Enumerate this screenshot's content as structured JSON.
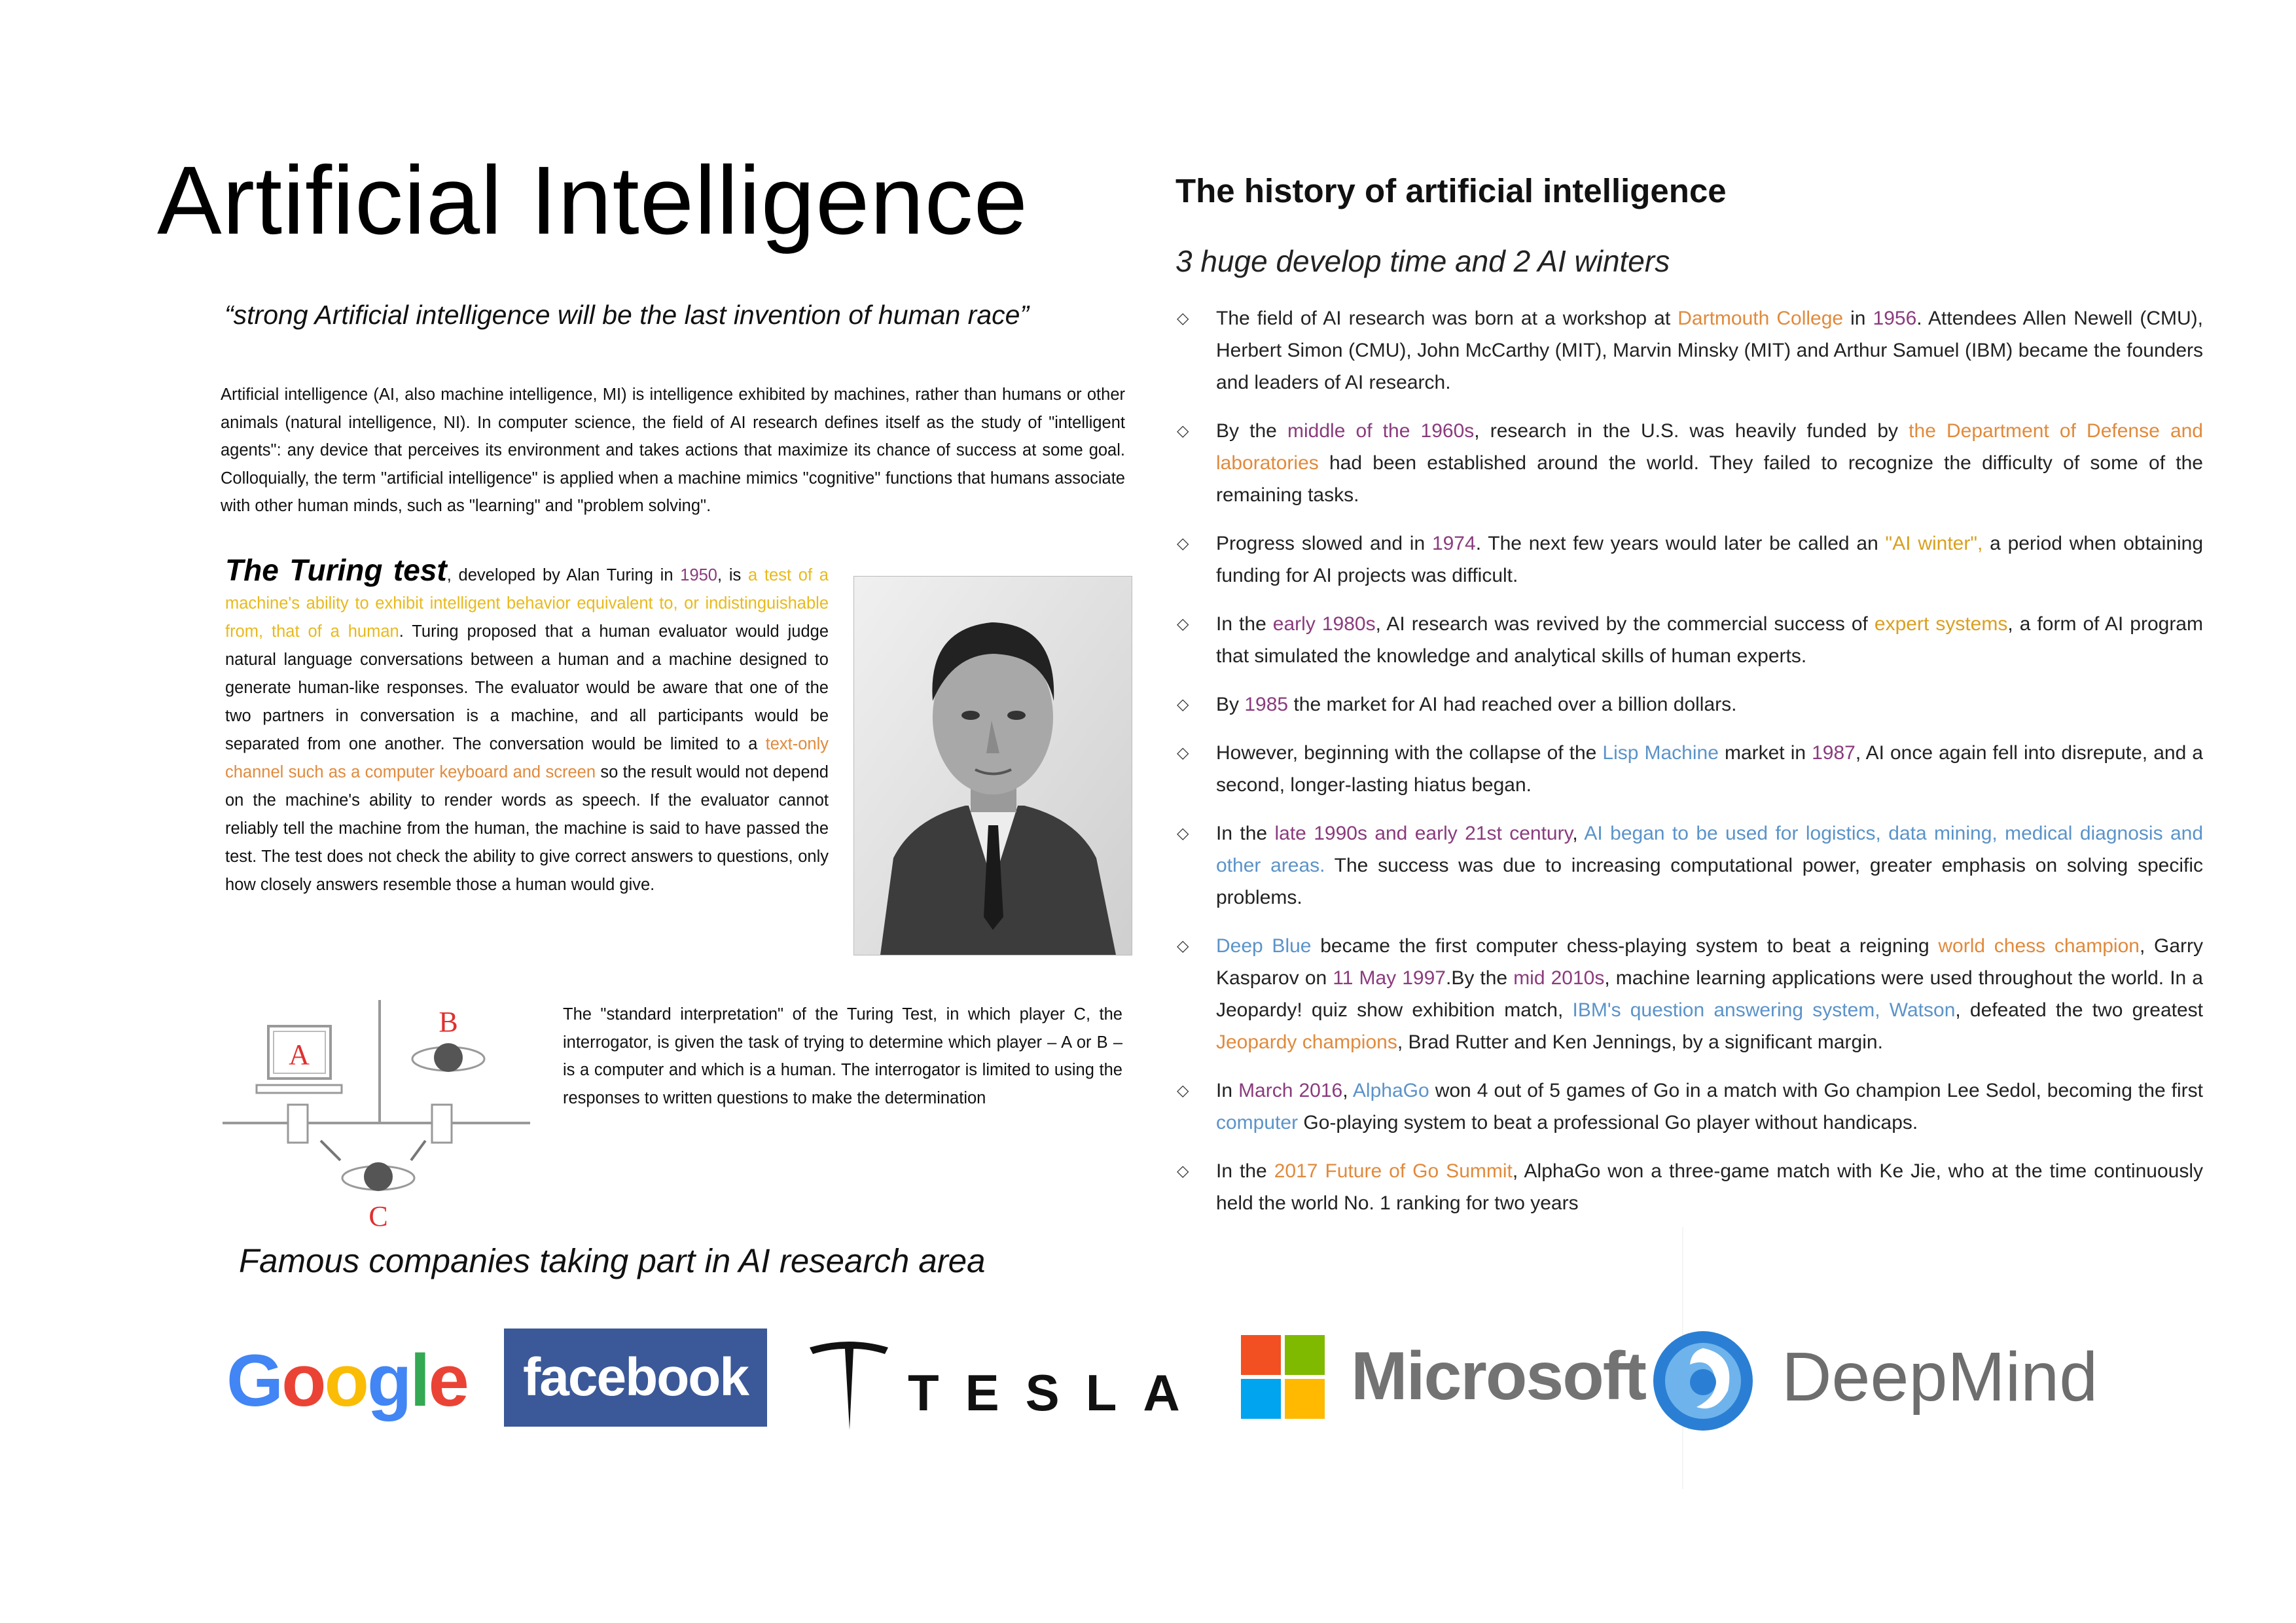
{
  "left": {
    "title": "Artificial Intelligence",
    "quote": "“strong Artificial intelligence will be the last invention of human race”",
    "intro": "Artificial intelligence (AI, also machine intelligence, MI) is intelligence exhibited by machines, rather than humans or other animals (natural intelligence, NI). In computer science, the field of AI research defines itself as the study of \"intelligent agents\": any device that perceives its environment and takes actions that maximize its chance of success at some goal. Colloquially, the term \"artificial intelligence\" is applied when a machine mimics \"cognitive\" functions that humans associate with other human minds, such as \"learning\" and \"problem solving\".",
    "turing": {
      "heading": "The Turing test",
      "s1": ", developed by Alan Turing in ",
      "year": "1950",
      "s2": ", is ",
      "def": "a test of a machine's ability to exhibit intelligent behavior equivalent to, or indistinguishable from, that of a human",
      "s3": ". Turing proposed that a human evaluator would judge natural language conversations between a human and a machine designed to generate human-like responses. The evaluator would be aware that one of the two partners in conversation is a machine, and all participants would be separated from one another. The conversation would be limited to a ",
      "channel": "text-only channel such as a computer keyboard and screen",
      "s4": " so the result would not depend on the machine's ability to render words as speech. If the evaluator cannot reliably tell the machine from the human, the machine is said to have passed the test. The test does not check the ability to give correct answers to questions, only how closely answers resemble those a human would give."
    },
    "diagram": {
      "label_a": "A",
      "label_b": "B",
      "label_c": "C"
    },
    "diagram_caption": "The \"standard interpretation\" of the Turing Test, in which player C, the interrogator, is given the task of trying to determine which player – A or B – is a computer and which is a human. The interrogator is limited to using the responses to written questions to make the determination",
    "companies_heading": "Famous companies taking part in AI research area"
  },
  "right": {
    "title": "The history of artificial intelligence",
    "subtitle": "3 huge develop time and 2 AI winters",
    "items": [
      {
        "a": "The field of AI research was born at a workshop at ",
        "b": "Dartmouth College",
        "c": " in ",
        "d": "1956",
        "e": ". Attendees Allen Newell (CMU), Herbert Simon (CMU), John McCarthy (MIT), Marvin Minsky (MIT) and Arthur Samuel (IBM) became the founders and leaders of AI research."
      },
      {
        "a": "By the ",
        "b": "middle of the 1960s",
        "c": ", research in the U.S. was heavily funded by ",
        "d": "the Department of Defense and laboratories",
        "e": " had been established around the world. They failed to recognize the difficulty of some of the remaining tasks."
      },
      {
        "a": "Progress slowed and in ",
        "b": "1974",
        "c": ". The next few years would later be called an ",
        "d": "\"AI winter\",",
        "e": " a period when obtaining funding for AI projects was difficult."
      },
      {
        "a": "In the ",
        "b": "early 1980s",
        "c": ", AI research was revived by the commercial success of ",
        "d": "expert systems",
        "e": ", a form of AI program that simulated the knowledge and analytical skills of human experts."
      },
      {
        "a": "By ",
        "b": "1985",
        "c": " the market for AI had reached over a billion dollars."
      },
      {
        "a": "However, beginning with the collapse of the ",
        "b": "Lisp Machine",
        "c": " market in ",
        "d": "1987",
        "e": ", AI once again fell into disrepute, and a second, longer-lasting hiatus began."
      },
      {
        "a": "In the ",
        "b": "late 1990s and early 21st century",
        "c": ", ",
        "d": "AI began to be used for logistics, data mining, medical diagnosis and other areas.",
        "e": " The success was due to increasing computational power, greater emphasis on solving specific problems."
      },
      {
        "a": "Deep Blue",
        "b": " became the first computer chess-playing system to beat a reigning ",
        "c": "world chess champion",
        "d": ", Garry Kasparov on ",
        "e": "11 May 1997",
        "f": ".By the ",
        "g": "mid 2010s",
        "h": ", machine learning applications were used throughout the world. In a Jeopardy! quiz show exhibition match, ",
        "i": "IBM's question answering system, Watson",
        "j": ", defeated the two greatest ",
        "k": "Jeopardy champions",
        "l": ", Brad Rutter and Ken Jennings, by a significant margin."
      },
      {
        "a": "In ",
        "b": "March 2016",
        "c": ", ",
        "d": "AlphaGo",
        "e": " won 4 out of 5 games of Go in a match with Go champion Lee Sedol, becoming the first ",
        "f": "computer",
        "g": " Go-playing system to beat a professional Go player without handicaps."
      },
      {
        "a": "In the ",
        "b": "2017 Future of Go Summit",
        "c": ", AlphaGo won a three-game match with Ke Jie, who at the time continuously held the world No. 1 ranking for two years"
      }
    ]
  },
  "logos": {
    "google": {
      "letters": [
        "G",
        "o",
        "o",
        "g",
        "l",
        "e"
      ],
      "colors": [
        "#4285F4",
        "#EA4335",
        "#FBBC05",
        "#4285F4",
        "#34A853",
        "#EA4335"
      ]
    },
    "facebook": {
      "text": "facebook",
      "color": "#3b5998"
    },
    "tesla": {
      "text": "TESLA",
      "color": "#111111"
    },
    "microsoft": {
      "text": "Microsoft",
      "colors": [
        "#F25022",
        "#7FBA00",
        "#00A4EF",
        "#FFB900"
      ]
    },
    "deepmind": {
      "text": "DeepMind",
      "color": "#4a90d9"
    }
  }
}
